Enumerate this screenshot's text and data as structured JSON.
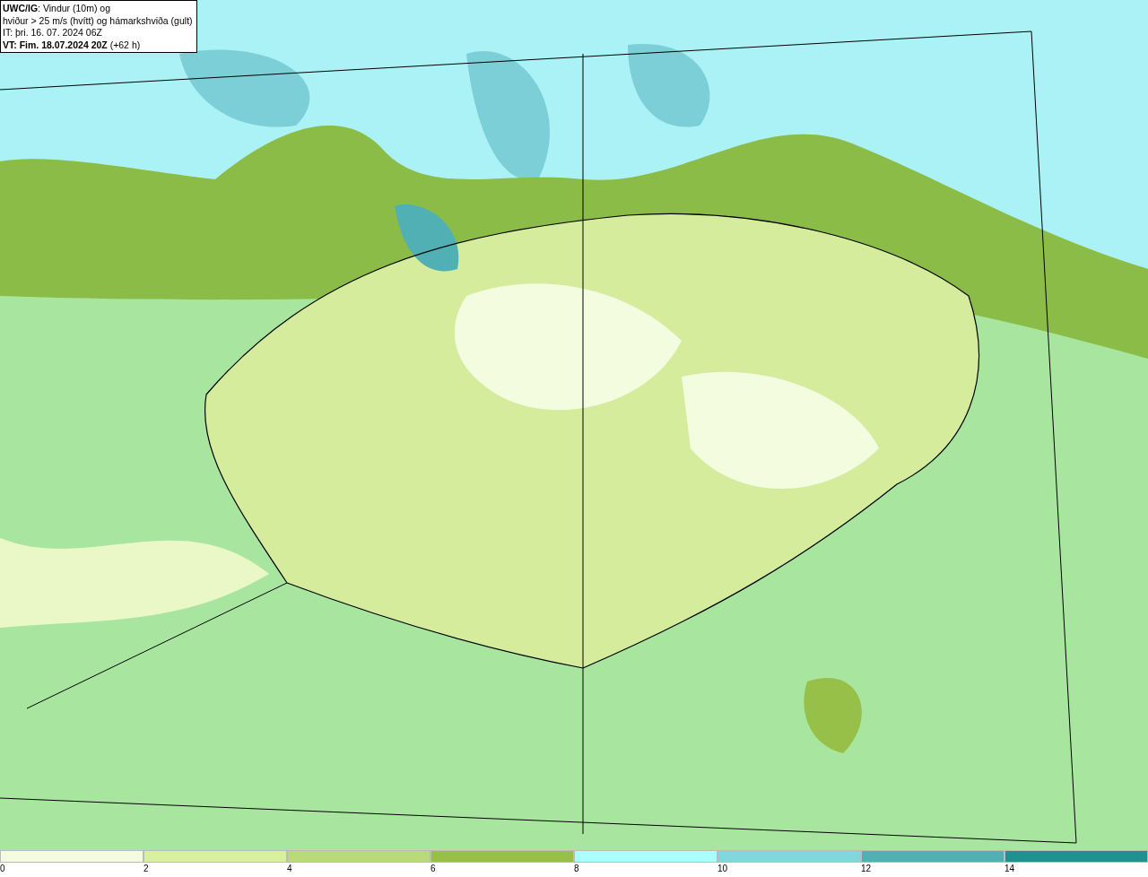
{
  "map": {
    "title_lines": [
      "**UWC/IG**: Vindur (10m) og",
      "hviður > 25 m/s (hvítt) og hámarkshviða (gult)",
      "IT: þri. 16. 07. 2024 06Z",
      "**VT: Fim. 18.07.2024 20Z** (+62 h)"
    ]
  },
  "legend": [
    {
      "label": "0",
      "color": "#f4fce0"
    },
    {
      "label": "2",
      "color": "#d8f0a0"
    },
    {
      "label": "4",
      "color": "#b8da78"
    },
    {
      "label": "6",
      "color": "#96c048"
    },
    {
      "label": "8",
      "color": "#aaffff"
    },
    {
      "label": "10",
      "color": "#80d8dc"
    },
    {
      "label": "12",
      "color": "#50b0b4"
    },
    {
      "label": "14",
      "color": "#209090"
    }
  ]
}
